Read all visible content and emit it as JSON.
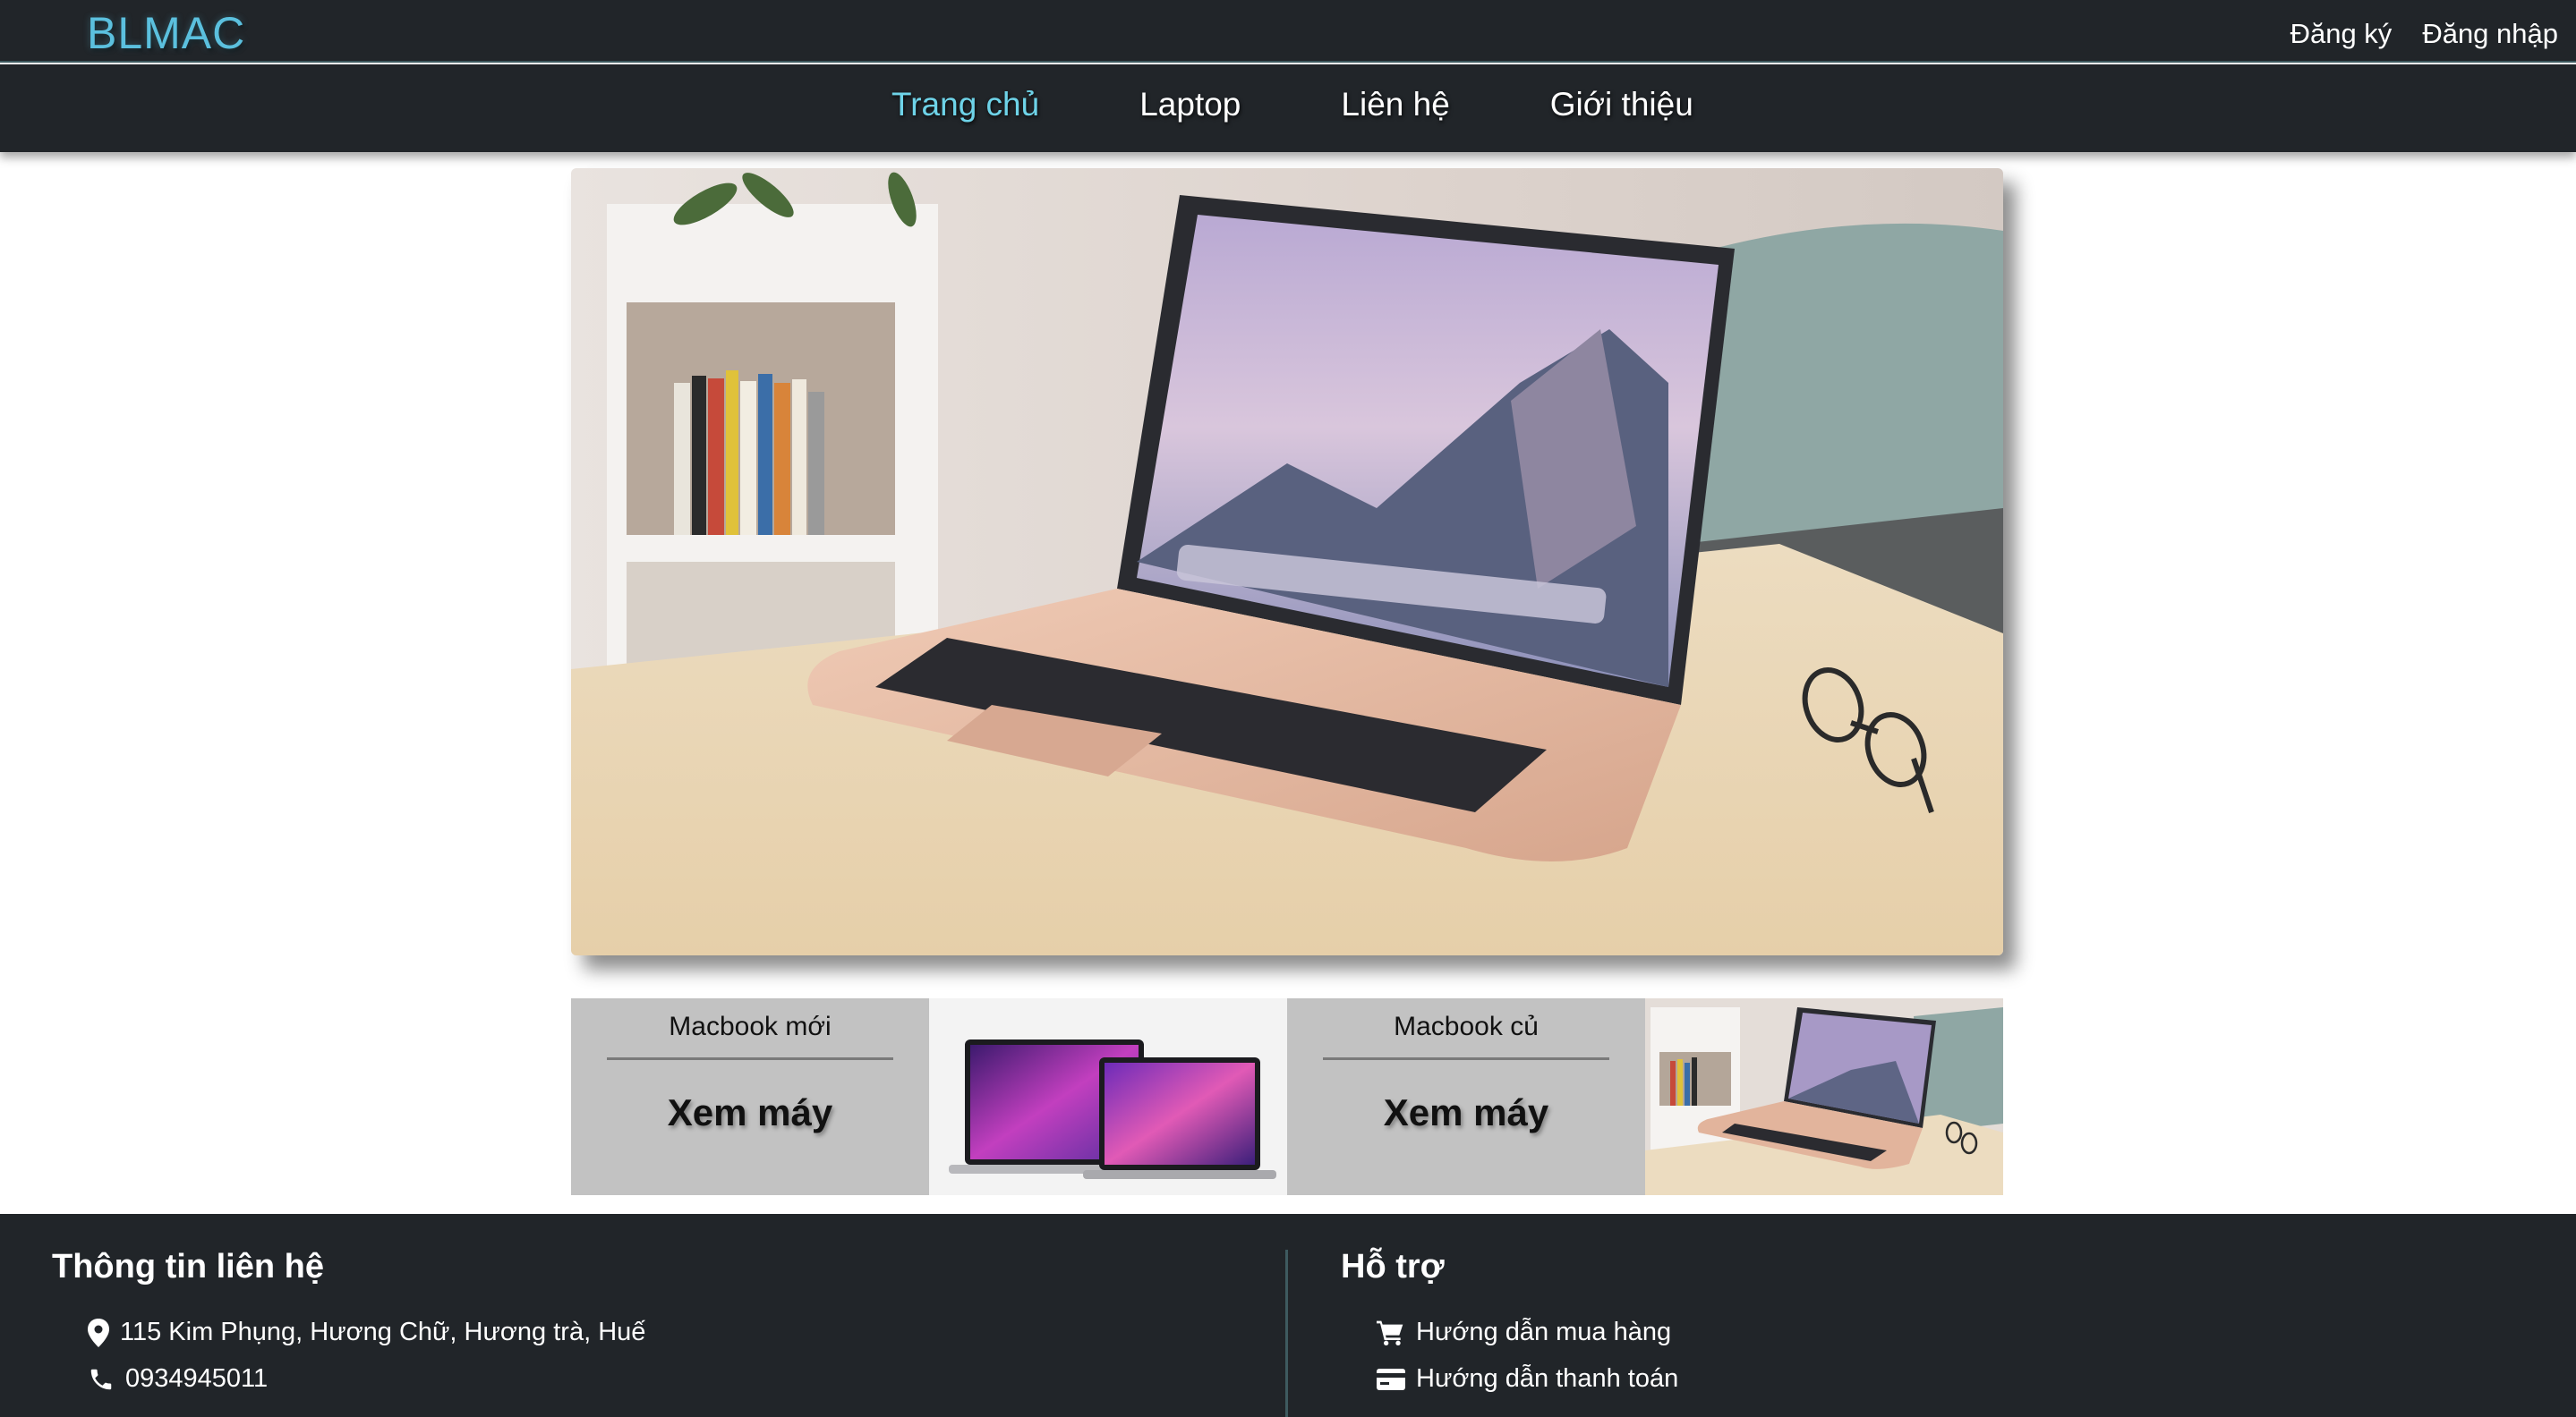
{
  "header": {
    "logo": "BLMAC",
    "register": "Đăng ký",
    "login": "Đăng nhập"
  },
  "nav": {
    "items": [
      "Trang chủ",
      "Laptop",
      "Liên hệ",
      "Giới thiệu"
    ],
    "active_index": 0
  },
  "hero": {
    "image": "macbook-air-gold-on-table"
  },
  "promos": [
    {
      "title": "Macbook mới",
      "cta": "Xem máy",
      "image": "macbook-pro-pair"
    },
    {
      "title": "Macbook củ",
      "cta": "Xem máy",
      "image": "macbook-air-on-table"
    }
  ],
  "footer": {
    "contact": {
      "title": "Thông tin liên hệ",
      "address": "115 Kim Phụng, Hương Chữ, Hương trà, Huế",
      "phone": "0934945011"
    },
    "support": {
      "title": "Hỗ trợ",
      "buy_guide": "Hướng dẫn mua hàng",
      "pay_guide": "Hướng dẫn thanh toán"
    }
  },
  "colors": {
    "header_bg": "#212529",
    "logo": "#5bc0de",
    "nav_active": "#6ed3e8",
    "promo_card": "#c2c2c2"
  }
}
